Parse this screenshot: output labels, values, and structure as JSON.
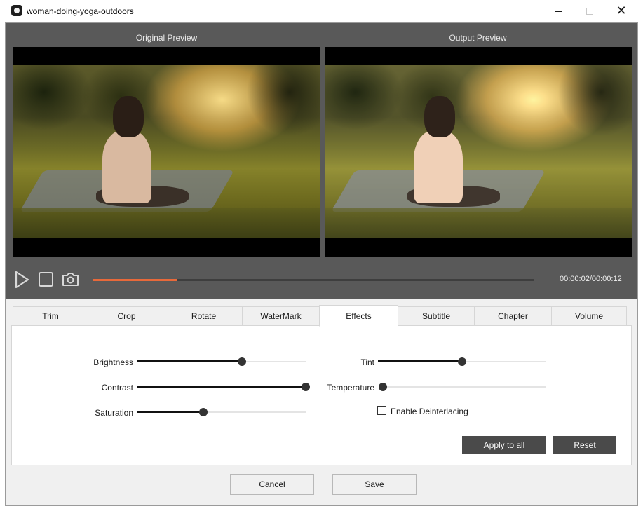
{
  "window": {
    "title": "woman-doing-yoga-outdoors",
    "icon": "app-logo-icon",
    "controls": [
      "minimize-icon",
      "maximize-icon",
      "close-icon"
    ]
  },
  "preview": {
    "original_label": "Original Preview",
    "output_label": "Output Preview"
  },
  "playback": {
    "time": "00:00:02/00:00:12",
    "progress_fraction": 0.19,
    "icons": [
      "play-icon",
      "stop-icon",
      "camera-icon"
    ],
    "accent_color": "#e8693a"
  },
  "tabs": [
    {
      "label": "Trim",
      "active": false
    },
    {
      "label": "Crop",
      "active": false
    },
    {
      "label": "Rotate",
      "active": false
    },
    {
      "label": "WaterMark",
      "active": false
    },
    {
      "label": "Effects",
      "active": true
    },
    {
      "label": "Subtitle",
      "active": false
    },
    {
      "label": "Chapter",
      "active": false
    },
    {
      "label": "Volume",
      "active": false
    }
  ],
  "effects": {
    "brightness": {
      "label": "Brightness",
      "value_fraction": 0.62
    },
    "contrast": {
      "label": "Contrast",
      "value_fraction": 1.0
    },
    "saturation": {
      "label": "Saturation",
      "value_fraction": 0.39
    },
    "tint": {
      "label": "Tint",
      "value_fraction": 0.5
    },
    "temperature": {
      "label": "Temperature",
      "value_fraction": 0.0
    },
    "deinterlace": {
      "label": "Enable Deinterlacing",
      "checked": false
    },
    "apply_all_label": "Apply to all",
    "reset_label": "Reset"
  },
  "footer": {
    "cancel_label": "Cancel",
    "save_label": "Save"
  }
}
